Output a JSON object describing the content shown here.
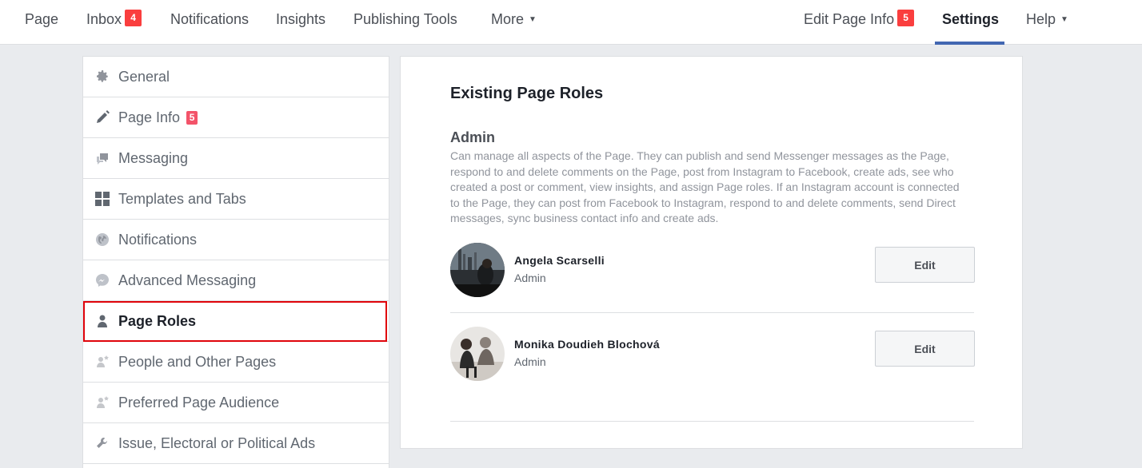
{
  "topnav": {
    "left": [
      {
        "label": "Page"
      },
      {
        "label": "Inbox",
        "badge": "4"
      },
      {
        "label": "Notifications"
      },
      {
        "label": "Insights"
      },
      {
        "label": "Publishing Tools"
      },
      {
        "label": "More"
      }
    ],
    "right": [
      {
        "label": "Edit Page Info",
        "badge": "5"
      },
      {
        "label": "Settings"
      },
      {
        "label": "Help"
      }
    ]
  },
  "sidebar": {
    "items": [
      {
        "label": "General",
        "icon": "gear-icon"
      },
      {
        "label": "Page Info",
        "icon": "pencil-icon",
        "badge": "5"
      },
      {
        "label": "Messaging",
        "icon": "chat-bubbles-icon"
      },
      {
        "label": "Templates and Tabs",
        "icon": "grid-icon"
      },
      {
        "label": "Notifications",
        "icon": "globe-icon"
      },
      {
        "label": "Advanced Messaging",
        "icon": "messenger-icon"
      },
      {
        "label": "Page Roles",
        "icon": "person-icon"
      },
      {
        "label": "People and Other Pages",
        "icon": "person-star-icon"
      },
      {
        "label": "Preferred Page Audience",
        "icon": "person-star-icon"
      },
      {
        "label": "Issue, Electoral or Political Ads",
        "icon": "wrench-icon"
      }
    ],
    "active_index": 6
  },
  "main": {
    "title": "Existing Page Roles",
    "role_title": "Admin",
    "role_desc": "Can manage all aspects of the Page. They can publish and send Messenger messages as the Page, respond to and delete comments on the Page, post from Instagram to Facebook, create ads, see who created a post or comment, view insights, and assign Page roles. If an Instagram account is connected to the Page, they can post from Facebook to Instagram, respond to and delete comments, send Direct messages, sync business contact info and create ads.",
    "people": [
      {
        "name": "Angela Scarselli",
        "role": "Admin",
        "button": "Edit"
      },
      {
        "name": "Monika Doudieh Blochová",
        "role": "Admin",
        "button": "Edit"
      }
    ]
  },
  "colors": {
    "accent": "#4267b2",
    "badge": "#fa3e3e",
    "highlight_border": "#e0040b",
    "background": "#e9ebee"
  }
}
